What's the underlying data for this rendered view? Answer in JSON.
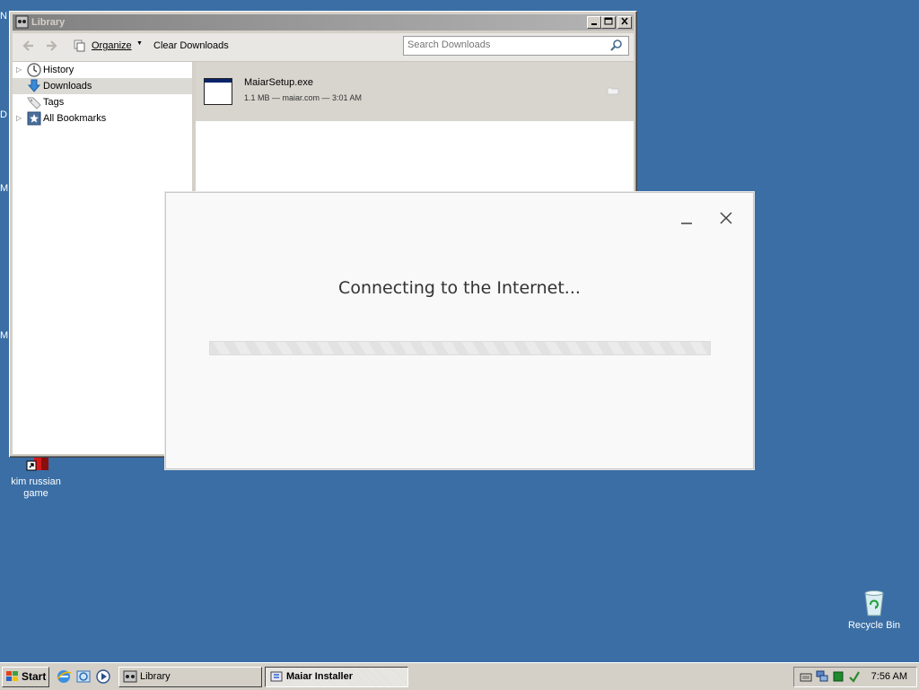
{
  "desktop": {
    "icons": [
      {
        "label": "kim russian game"
      },
      {
        "label": "Recycle Bin"
      }
    ],
    "edge_letters": [
      "N",
      "D",
      "M",
      "M"
    ]
  },
  "library": {
    "title": "Library",
    "toolbar": {
      "organize_label": "Organize",
      "clear_label": "Clear Downloads",
      "search_placeholder": "Search Downloads"
    },
    "sidebar": [
      {
        "label": "History",
        "icon": "clock-icon",
        "selected": false,
        "expandable": true
      },
      {
        "label": "Downloads",
        "icon": "download-arrow-icon",
        "selected": true,
        "expandable": false
      },
      {
        "label": "Tags",
        "icon": "tag-icon",
        "selected": false,
        "expandable": false
      },
      {
        "label": "All Bookmarks",
        "icon": "bookmark-star-icon",
        "selected": false,
        "expandable": true
      }
    ],
    "downloads": [
      {
        "name": "MaiarSetup.exe",
        "meta": "1.1 MB — maiar.com — 3:01 AM"
      }
    ]
  },
  "installer": {
    "status": "Connecting to the Internet..."
  },
  "taskbar": {
    "start_label": "Start",
    "buttons": [
      {
        "label": "Library",
        "active": false
      },
      {
        "label": "Maiar Installer",
        "active": true
      }
    ],
    "clock": "7:56 AM"
  }
}
